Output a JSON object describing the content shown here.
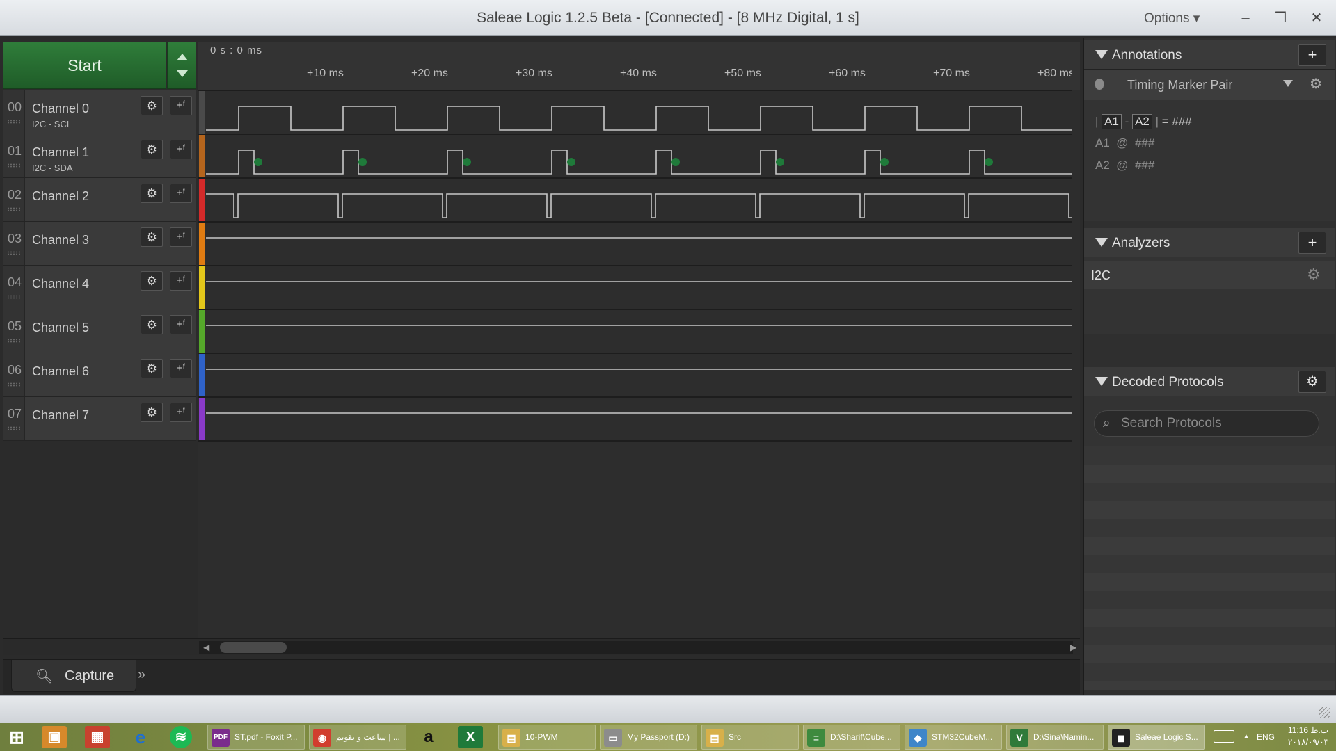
{
  "window": {
    "title": "Saleae Logic 1.2.5 Beta - [Connected] - [8 MHz Digital, 1 s]",
    "options_label": "Options ▾",
    "minimize_label": "–",
    "restore_label": "❐",
    "close_label": "✕"
  },
  "controls": {
    "start_label": "Start"
  },
  "timeline": {
    "origin_label": "0 s : 0 ms",
    "ticks": [
      "+10 ms",
      "+20 ms",
      "+30 ms",
      "+40 ms",
      "+50 ms",
      "+60 ms",
      "+70 ms",
      "+80 ms"
    ]
  },
  "channels": [
    {
      "num": "00",
      "name": "Channel 0",
      "sub": "I2C - SCL",
      "color": "#4a4a4a"
    },
    {
      "num": "01",
      "name": "Channel 1",
      "sub": "I2C - SDA",
      "color": "#b5651d"
    },
    {
      "num": "02",
      "name": "Channel 2",
      "sub": "",
      "color": "#d42a2a"
    },
    {
      "num": "03",
      "name": "Channel 3",
      "sub": "",
      "color": "#e07c12"
    },
    {
      "num": "04",
      "name": "Channel 4",
      "sub": "",
      "color": "#e3c71a"
    },
    {
      "num": "05",
      "name": "Channel 5",
      "sub": "",
      "color": "#55a82a"
    },
    {
      "num": "06",
      "name": "Channel 6",
      "sub": "",
      "color": "#2f62c8"
    },
    {
      "num": "07",
      "name": "Channel 7",
      "sub": "",
      "color": "#8a3ac8"
    }
  ],
  "tabs": {
    "capture_label": "Capture",
    "more_label": "»"
  },
  "annotations": {
    "title": "Annotations",
    "add_label": "+",
    "marker_pair_label": "Timing Marker Pair",
    "formula": {
      "a1": "A1",
      "a2": "A2",
      "minus": "-",
      "equals": "= ###"
    },
    "a1_line": {
      "label": "A1",
      "at": "@",
      "value": "###"
    },
    "a2_line": {
      "label": "A2",
      "at": "@",
      "value": "###"
    }
  },
  "analyzers": {
    "title": "Analyzers",
    "add_label": "+",
    "items": [
      {
        "name": "I2C"
      }
    ]
  },
  "decoded_protocols": {
    "title": "Decoded Protocols",
    "search_placeholder": "Search Protocols"
  },
  "taskbar": {
    "items": [
      {
        "label": "ST.pdf - Foxit P...",
        "icon": "PDF",
        "color": "#7a2c8c"
      },
      {
        "label": "ساعت و تقویم | ...",
        "icon": "◉",
        "color": "#d13d2e"
      },
      {
        "label": "10-PWM",
        "icon": "▤",
        "color": "#d8b04a"
      },
      {
        "label": "My Passport (D:)",
        "icon": "▭",
        "color": "#8c8c8c"
      },
      {
        "label": "Src",
        "icon": "▤",
        "color": "#d8b04a"
      },
      {
        "label": "D:\\Sharif\\Cube...",
        "icon": "≡",
        "color": "#3e8a3e"
      },
      {
        "label": "STM32CubeM...",
        "icon": "◆",
        "color": "#3f86c9"
      },
      {
        "label": "D:\\Sina\\Namin...",
        "icon": "V",
        "color": "#2f7a3a"
      },
      {
        "label": "Saleae Logic S...",
        "icon": "◼",
        "color": "#222222"
      }
    ],
    "lang": "ENG",
    "time": "11:16 ب.ظ",
    "date": "۲۰۱۸/۰۹/۰۳"
  }
}
